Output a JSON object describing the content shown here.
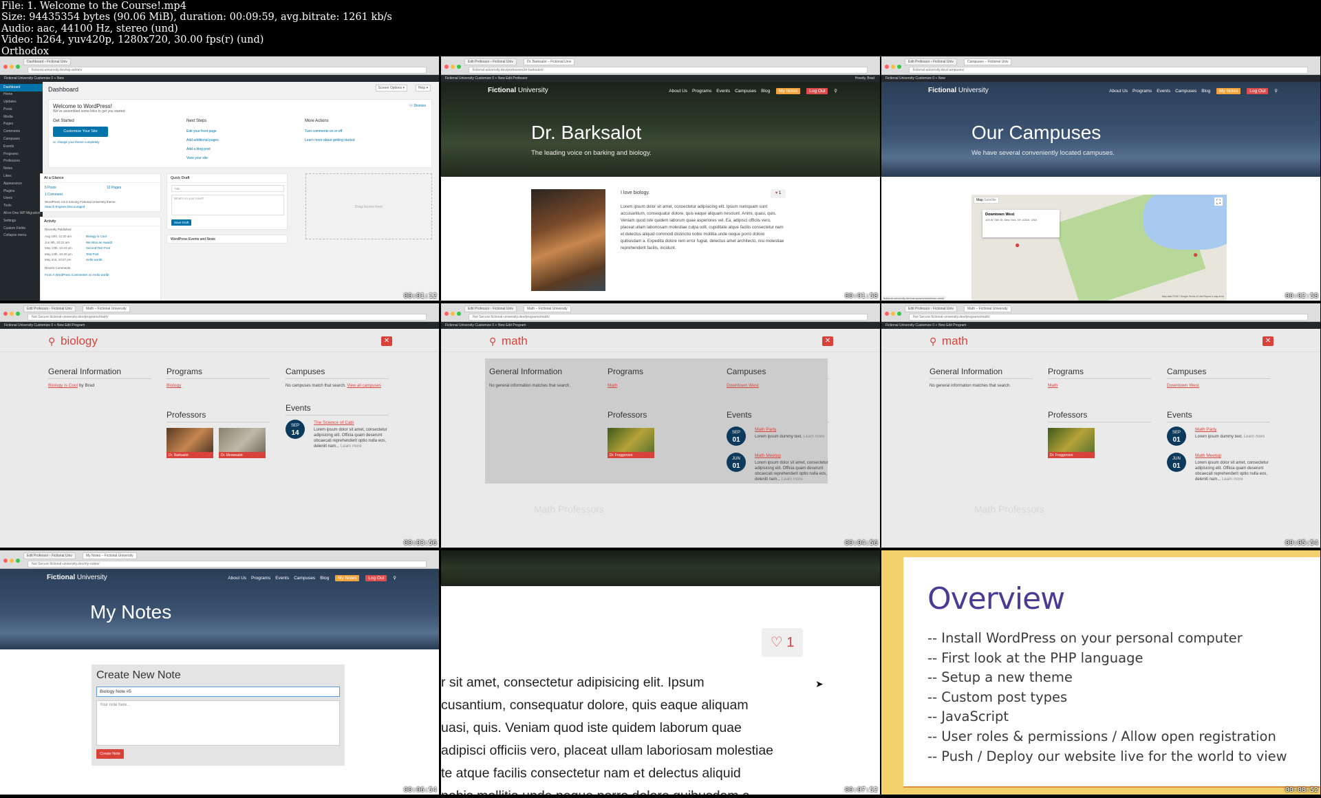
{
  "header": {
    "lines": [
      "File: 1. Welcome to the Course!.mp4",
      "Size: 94435354 bytes (90.06 MiB), duration: 00:09:59, avg.bitrate: 1261 kb/s",
      "Audio: aac, 44100 Hz, stereo (und)",
      "Video: h264, yuv420p, 1280x720, 30.00 fps(r) (und)",
      "Orthodox"
    ]
  },
  "colors": {
    "accent": "#d9423b",
    "navy": "#0c3a5c",
    "wp_blue": "#0073aa",
    "slide_purple": "#4d3a95",
    "slide_border": "#f2d06b"
  },
  "thumbs": [
    {
      "time": "00:01:12"
    },
    {
      "time": "00:01:58"
    },
    {
      "time": "00:02:58"
    },
    {
      "time": "00:03:56"
    },
    {
      "time": "00:04:56"
    },
    {
      "time": "00:05:54"
    },
    {
      "time": "00:06:54"
    },
    {
      "time": "00:07:52"
    },
    {
      "time": "00:08:52"
    }
  ],
  "site": {
    "logo_bold": "Fictional",
    "logo_rest": " University",
    "nav": [
      "About Us",
      "Programs",
      "Events",
      "Campuses",
      "Blog"
    ],
    "my_notes": "My Notes",
    "log_out": "Log Out"
  },
  "dash": {
    "tab1": "Dashboard ‹ Fictional Univ",
    "url": "fictional-university.dev/wp-admin/",
    "bar": "Fictional University   Customize   0   + New",
    "sidebar": [
      "Dashboard",
      "Home",
      "Updates",
      "Posts",
      "Media",
      "Pages",
      "Comments",
      "Campuses",
      "Events",
      "Programs",
      "Professors",
      "Notes",
      "Likes",
      "Appearance",
      "Plugins",
      "Users",
      "Tools",
      "All-in-One WP Migration",
      "Settings",
      "Custom Fields",
      "Collapse menu"
    ],
    "title": "Dashboard",
    "screen_options": "Screen Options ▾",
    "help": "Help ▾",
    "welcome": "Welcome to WordPress!",
    "welcome_sub": "We've assembled some links to get you started:",
    "dismiss": "Dismiss",
    "get_started": "Get Started",
    "customize_btn": "Customize Your Site",
    "or_change": "or, change your theme completely",
    "next_steps": "Next Steps",
    "next_items": [
      "Edit your front page",
      "Add additional pages",
      "Add a blog post",
      "View your site"
    ],
    "more_actions": "More Actions",
    "more_items": [
      "Turn comments on or off",
      "Learn more about getting started"
    ],
    "glance": "At a Glance",
    "posts": "5 Posts",
    "pages": "12 Pages",
    "comment": "1 Comment",
    "running": "WordPress 4.8.2 running Fictional University theme.",
    "discouraged": "Search Engines Discouraged",
    "quick_draft": "Quick Draft",
    "qd_title": "Title",
    "qd_mind": "What's on your mind?",
    "save_draft": "Save Draft",
    "drag": "Drag boxes here",
    "activity": "Activity",
    "recently": "Recently Published",
    "rows": [
      {
        "d": "Aug 10th, 11:20 am",
        "t": "Biology is Cool"
      },
      {
        "d": "Jun 8th, 10:22 am",
        "t": "We Won an Award!"
      },
      {
        "d": "May 13th, 10:43 pm",
        "t": "Second Test Post"
      },
      {
        "d": "May 13th, 10:40 pm",
        "t": "Test Post"
      },
      {
        "d": "May 2nd, 10:07 pm",
        "t": "Hello world!"
      }
    ],
    "recent_comments": "Recent Comments",
    "comment_line": "From A WordPress Commenter on Hello world!",
    "events_news": "WordPress Events and News"
  },
  "barksalot": {
    "tab1": "Edit Professor ‹ Fictional Univ",
    "tab2": "Dr. Barksalot – Fictional Univ",
    "url": "fictional-university.dev/professors/dr-barksalot/",
    "bar": "Fictional University   Customize   0   + New   Edit Professor",
    "howdy": "Howdy, Brad",
    "title": "Dr. Barksalot",
    "subtitle": "The leading voice on barking and biology.",
    "love": "I love biology.",
    "likes": "1",
    "body": "Lorem ipsum dolor sit amet, consectetur adipisicing elit. Ipsum numquam sunt accusantium, consequatur dolore, quis eaque aliquam nesciunt. Animi, quasi, quis. Veniam quod iste quidem laborum quae asperiores vel. Ea, adipisci officiis vero, placeat ullam laboriosam molestiae culpa odit, cupiditate atque facilis consectetur nam et delectus aliquid commodi distinctio nobis mollitia unde neque porro dolore quibusdam a. Expedita dolore rem error fugiat, delectus amet architecto, nisi molestiae reprehenderit facilis, incidunt."
  },
  "campuses": {
    "tab1": "Edit Professor ‹ Fictional Univ",
    "tab2": "Campuses – Fictional Univ",
    "url": "fictional-university.dev/campuses/",
    "bar": "Fictional University   Customize   0   + New",
    "title": "Our Campuses",
    "subtitle": "We have several conveniently located campuses.",
    "map_btn": "Map",
    "sat_btn": "Satellite",
    "info_title": "Downtown West",
    "info_addr": "100 W 76th St, New York, NY 10024, USA",
    "status": "fictional-university.dev/campuses/downtown-west/",
    "map_footer": "Map data ©2017 Google   Terms of Use   Report a map error"
  },
  "search1": {
    "tab1": "Edit Professor ‹ Fictional Univ",
    "tab2": "Math – Fictional University",
    "url": "Not Secure   fictional-university.dev/programs/math/",
    "bar": "Fictional University   Customize   0   + New   Edit Program",
    "term": "biology",
    "general": "General Information",
    "gen_link": "Biology is Cool",
    "gen_by": "by Brad",
    "programs": "Programs",
    "prog_link": "Biology",
    "campuses": "Campuses",
    "camp_none": "No campuses match that search.",
    "camp_view": "View all campuses",
    "professors": "Professors",
    "profs": [
      "Dr. Barksalot",
      "Dr. Meowsalot"
    ],
    "events": "Events",
    "ev_mon": "SEP",
    "ev_day": "14",
    "ev_title": "The Science of Cats",
    "ev_text": "Lorem ipsum dolor sit amet, consectetur adipisicing elit. Officia quam deserunt obcaecati reprehenderit optio nulla eos, deleniti nam...",
    "ev_more": "Learn more"
  },
  "search2": {
    "term": "math",
    "general": "General Information",
    "gen_none": "No general information matches that search.",
    "programs": "Programs",
    "prog_link": "Math",
    "campuses": "Campuses",
    "camp_link": "Downtown West",
    "professors": "Professors",
    "prof": "Dr. Froggerson",
    "events": "Events",
    "ev1_mon": "SEP",
    "ev1_day": "01",
    "ev1_title": "Math Party",
    "ev1_text": "Lorem ipsum dummy text.",
    "ev1_more": "Learn more",
    "ev2_mon": "JUN",
    "ev2_day": "01",
    "ev2_title": "Math Meetup",
    "ev2_text": "Lorem ipsum dolor sit amet, consectetur adipisicing elit. Officia quam deserunt obcaecati reprehenderit optio nulla eos, deleniti nam...",
    "ev2_more": "Learn more",
    "bg_heading": "Math Professors"
  },
  "notes": {
    "tab1": "Edit Professor ‹ Fictional Univ",
    "tab2": "My Notes – Fictional University",
    "url": "Not Secure   fictional-university.dev/my-notes/",
    "title": "My Notes",
    "create": "Create New Note",
    "note_title": "Biology Note #5",
    "note_body_ph": "Your note here...",
    "create_btn": "Create Note"
  },
  "zoom": {
    "likes": "1",
    "lines": [
      "r sit amet, consectetur adipisicing elit. Ipsum",
      "cusantium, consequatur dolore, quis eaque aliquam",
      "uasi, quis. Veniam quod iste quidem laborum quae",
      "adipisci officiis vero, placeat ullam laboriosam molestiae",
      "te atque facilis consectetur nam et delectus aliquid",
      "nobis mollitia unde neque porro dolore quibusdam a"
    ]
  },
  "overview": {
    "title": "Overview",
    "items": [
      "-- Install WordPress on your personal computer",
      "-- First look at the PHP language",
      "-- Setup a new theme",
      "-- Custom post types",
      "-- JavaScript",
      "-- User roles & permissions / Allow open registration",
      "-- Push / Deploy our website live for the world to view"
    ]
  }
}
